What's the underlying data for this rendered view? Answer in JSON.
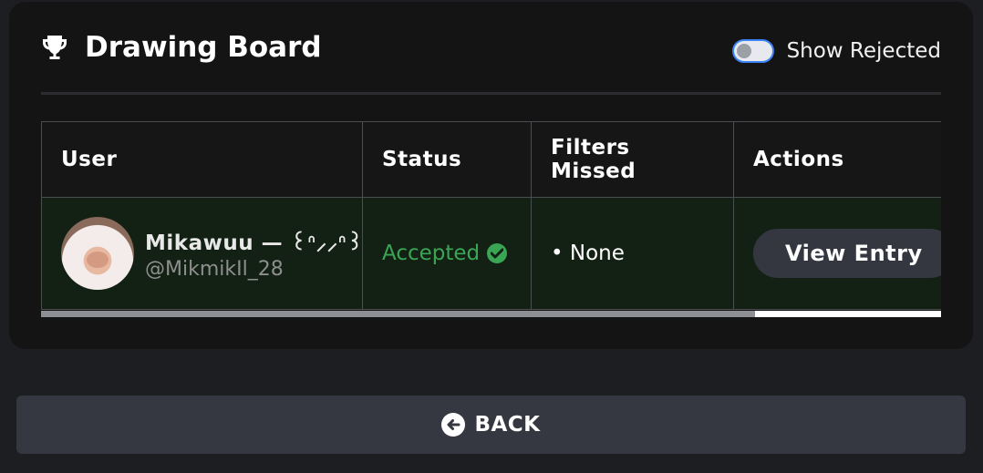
{
  "header": {
    "title": "Drawing Board",
    "icon": "trophy-icon",
    "toggle_label": "Show Rejected",
    "toggle_on": false
  },
  "table": {
    "columns": [
      "User",
      "Status",
      "Filters Missed",
      "Actions"
    ],
    "rows": [
      {
        "user_name": "Mikawuu — ꒰ᐢ⸝⸝ᐢ꒱",
        "user_handle": "@MikmikIl_28",
        "status": "Accepted",
        "filters_missed": "• None",
        "action_label": "View Entry"
      }
    ]
  },
  "colors": {
    "accepted": "#3aa655",
    "row_background": "#132114",
    "card_background": "#141414"
  },
  "footer": {
    "back_label": "BACK"
  }
}
